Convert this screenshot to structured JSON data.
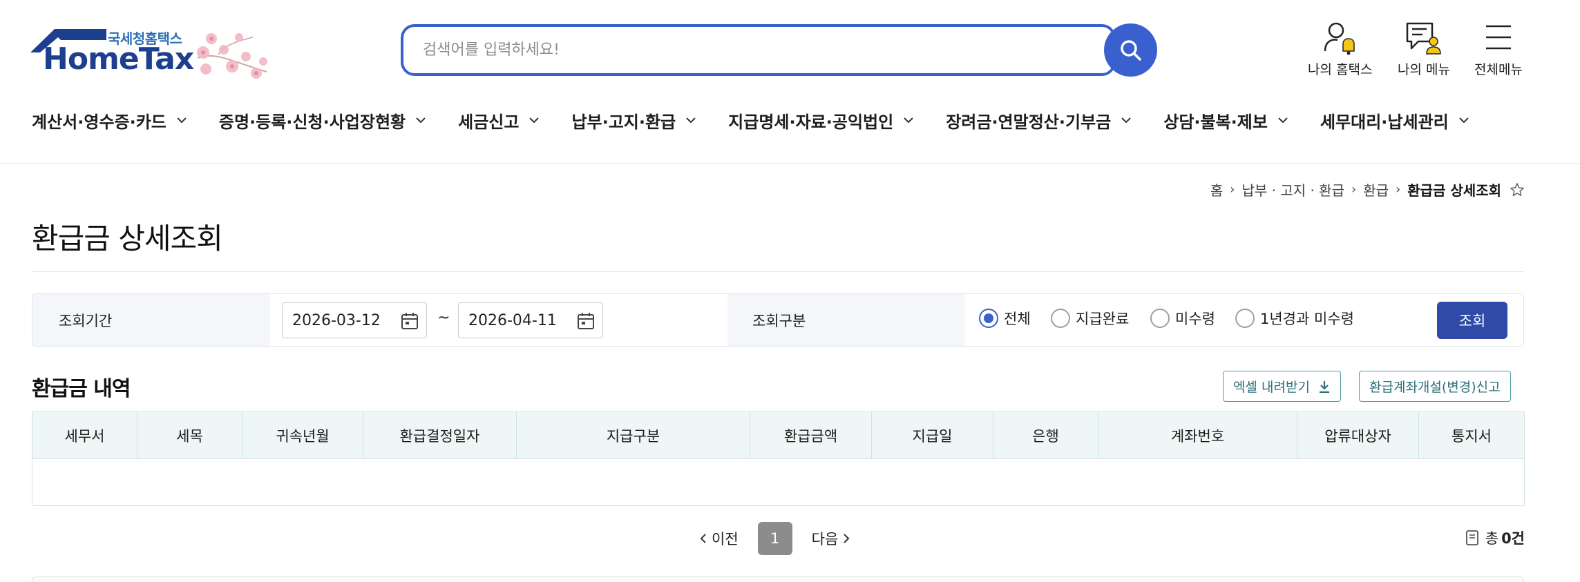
{
  "header": {
    "logo_sub": "국세청홈택스",
    "logo_main": "HomeTax",
    "search_placeholder": "검색어를 입력하세요!",
    "utils": [
      {
        "label": "나의 홈택스",
        "icon": "person-bell-icon"
      },
      {
        "label": "나의 메뉴",
        "icon": "document-person-icon"
      },
      {
        "label": "전체메뉴",
        "icon": "hamburger-menu-icon"
      }
    ],
    "nav": [
      "계산서·영수증·카드",
      "증명·등록·신청·사업장현황",
      "세금신고",
      "납부·고지·환급",
      "지급명세·자료·공익법인",
      "장려금·연말정산·기부금",
      "상담·불복·제보",
      "세무대리·납세관리"
    ]
  },
  "breadcrumb": [
    "홈",
    "납부 · 고지 · 환급",
    "환급",
    "환급금 상세조회"
  ],
  "page_title": "환급금 상세조회",
  "filter": {
    "period_label": "조회기간",
    "start_date": "2026-03-12",
    "tilde": "~",
    "end_date": "2026-04-11",
    "type_label": "조회구분",
    "options": [
      "전체",
      "지급완료",
      "미수령",
      "1년경과 미수령"
    ],
    "selected": "전체",
    "query_button": "조회"
  },
  "section": {
    "title": "환급금 내역",
    "excel_button": "엑셀 내려받기",
    "account_button": "환급계좌개설(변경)신고"
  },
  "table": {
    "columns": [
      "세무서",
      "세목",
      "귀속년월",
      "환급결정일자",
      "지급구분",
      "환급금액",
      "지급일",
      "은행",
      "계좌번호",
      "압류대상자",
      "통지서"
    ],
    "rows": []
  },
  "pagination": {
    "prev": "이전",
    "page": "1",
    "next": "다음"
  },
  "total": {
    "prefix": "총",
    "count": "0건"
  },
  "colors": {
    "primary": "#3a5fce",
    "button": "#2f4aa7",
    "teal": "#2b6f7a",
    "header_bg": "#eef6f6"
  }
}
